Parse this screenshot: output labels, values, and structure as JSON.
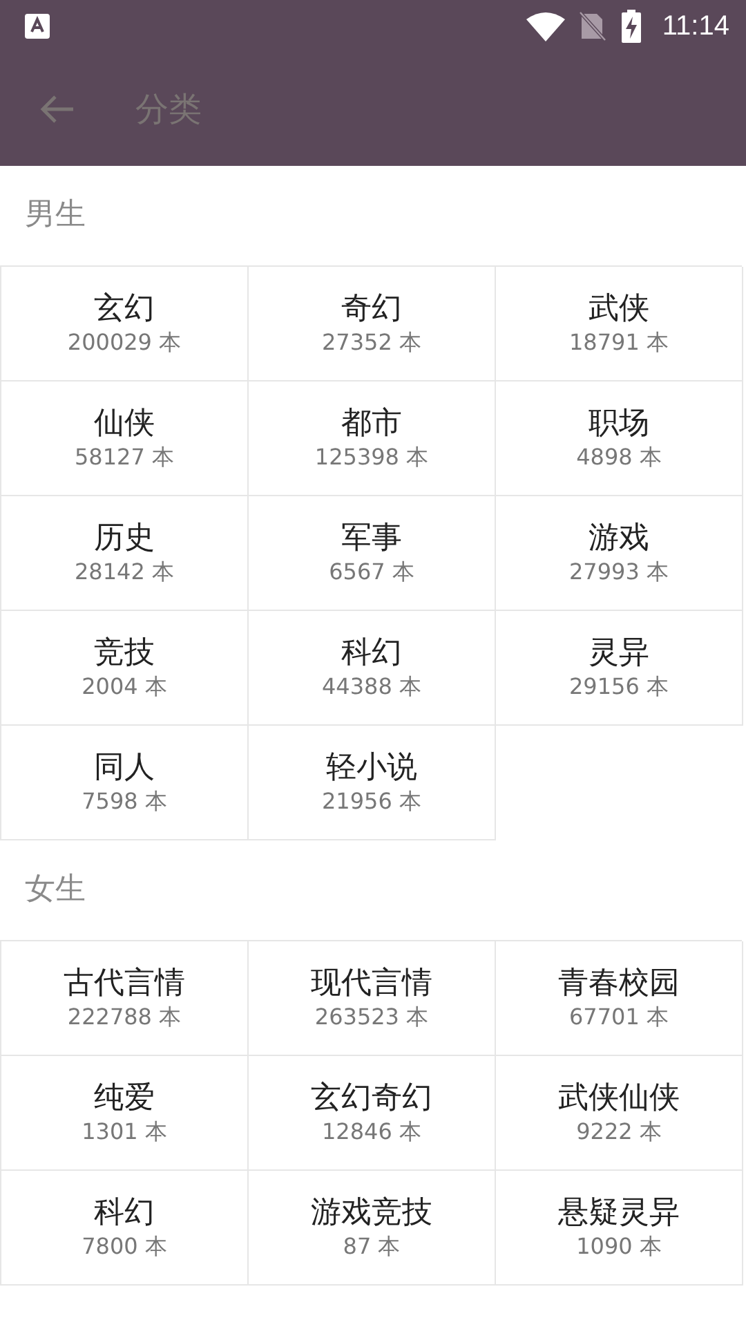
{
  "status_bar": {
    "time": "11:14"
  },
  "toolbar": {
    "title": "分类"
  },
  "sections": [
    {
      "title": "男生",
      "categories": [
        {
          "name": "玄幻",
          "count": "200029 本"
        },
        {
          "name": "奇幻",
          "count": "27352 本"
        },
        {
          "name": "武侠",
          "count": "18791 本"
        },
        {
          "name": "仙侠",
          "count": "58127 本"
        },
        {
          "name": "都市",
          "count": "125398 本"
        },
        {
          "name": "职场",
          "count": "4898 本"
        },
        {
          "name": "历史",
          "count": "28142 本"
        },
        {
          "name": "军事",
          "count": "6567 本"
        },
        {
          "name": "游戏",
          "count": "27993 本"
        },
        {
          "name": "竞技",
          "count": "2004 本"
        },
        {
          "name": "科幻",
          "count": "44388 本"
        },
        {
          "name": "灵异",
          "count": "29156 本"
        },
        {
          "name": "同人",
          "count": "7598 本"
        },
        {
          "name": "轻小说",
          "count": "21956 本"
        }
      ]
    },
    {
      "title": "女生",
      "categories": [
        {
          "name": "古代言情",
          "count": "222788 本"
        },
        {
          "name": "现代言情",
          "count": "263523 本"
        },
        {
          "name": "青春校园",
          "count": "67701 本"
        },
        {
          "name": "纯爱",
          "count": "1301 本"
        },
        {
          "name": "玄幻奇幻",
          "count": "12846 本"
        },
        {
          "name": "武侠仙侠",
          "count": "9222 本"
        },
        {
          "name": "科幻",
          "count": "7800 本"
        },
        {
          "name": "游戏竞技",
          "count": "87 本"
        },
        {
          "name": "悬疑灵异",
          "count": "1090 本"
        }
      ]
    }
  ]
}
